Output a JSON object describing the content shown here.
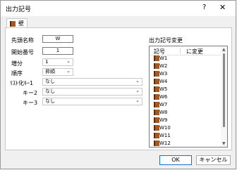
{
  "window": {
    "title": "出力記号",
    "help": "?",
    "close": "✕"
  },
  "tab": {
    "label": "壁",
    "icon": "book-icon"
  },
  "form": {
    "prefix": {
      "label": "先頭名称",
      "value": "W"
    },
    "start": {
      "label": "開始番号",
      "value": "1"
    },
    "increment": {
      "label": "増分",
      "value": "1"
    },
    "order": {
      "label": "順序",
      "value": "昇順"
    },
    "listkey1": {
      "label": "ﾘｽﾄ化ｷｰ1",
      "value": "なし"
    },
    "key2": {
      "label": "キー2",
      "value": "なし"
    },
    "key3": {
      "label": "キー3",
      "value": "なし"
    }
  },
  "list": {
    "title": "出力記号変更",
    "columns": [
      "記号",
      "に変更"
    ],
    "items": [
      "W1",
      "W2",
      "W3",
      "W4",
      "W5",
      "W6",
      "W7",
      "W8",
      "W9",
      "W10",
      "W11",
      "W12"
    ]
  },
  "buttons": {
    "ok": "OK",
    "cancel": "キャンセル"
  }
}
